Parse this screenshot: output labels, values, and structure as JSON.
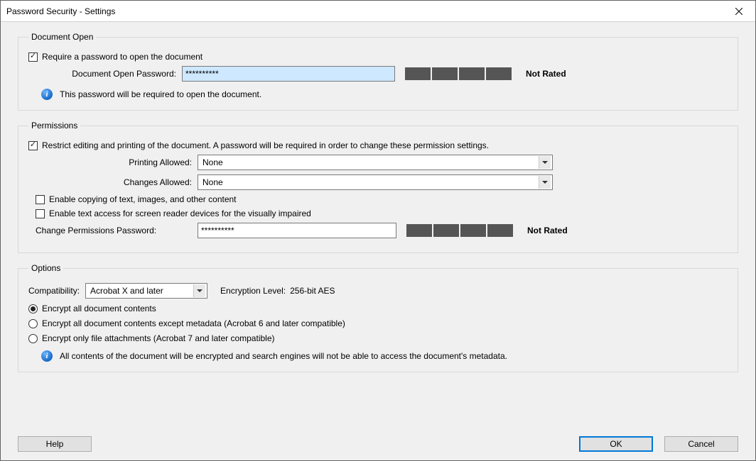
{
  "window": {
    "title": "Password Security - Settings"
  },
  "document_open": {
    "legend": "Document Open",
    "require_checkbox": "Require a password to open the document",
    "require_checked": true,
    "pw_label": "Document Open Password:",
    "pw_value": "**********",
    "rating": "Not Rated",
    "info": "This password will be required to open the document."
  },
  "permissions": {
    "legend": "Permissions",
    "restrict_checkbox": "Restrict editing and printing of the document. A password will be required in order to change these permission settings.",
    "restrict_checked": true,
    "printing_label": "Printing Allowed:",
    "printing_value": "None",
    "changes_label": "Changes Allowed:",
    "changes_value": "None",
    "enable_copy": "Enable copying of text, images, and other content",
    "enable_copy_checked": false,
    "enable_access": "Enable text access for screen reader devices for the visually impaired",
    "enable_access_checked": false,
    "perm_pw_label": "Change Permissions Password:",
    "perm_pw_value": "**********",
    "perm_rating": "Not Rated"
  },
  "options": {
    "legend": "Options",
    "compat_label": "Compatibility:",
    "compat_value": "Acrobat X and later",
    "enc_level_label": "Encryption  Level:",
    "enc_level_value": "256-bit AES",
    "radio1": "Encrypt all document contents",
    "radio2": "Encrypt all document contents except metadata (Acrobat 6 and later compatible)",
    "radio3": "Encrypt only file attachments (Acrobat 7 and later compatible)",
    "selected_radio": 1,
    "info": "All contents of the document will be encrypted and search engines will not be able to access the document's metadata."
  },
  "buttons": {
    "help": "Help",
    "ok": "OK",
    "cancel": "Cancel"
  },
  "icons": {
    "info_glyph": "i"
  }
}
